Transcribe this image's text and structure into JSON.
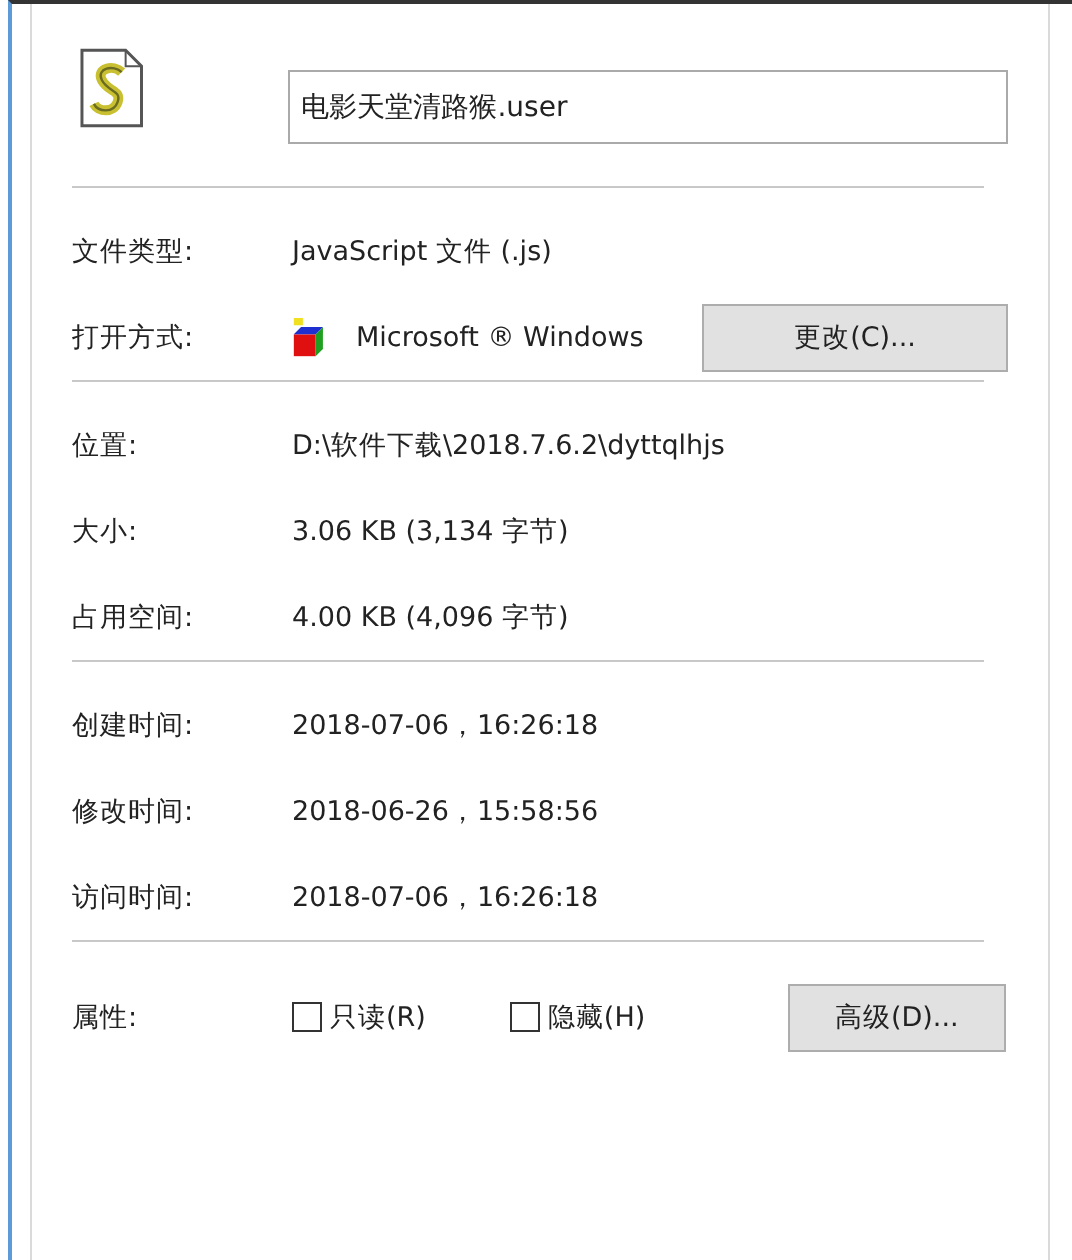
{
  "file_name": {
    "value": "电影天堂清路猴.user"
  },
  "sections": [
    {
      "rows": [
        {
          "kind": "text",
          "label": "文件类型:",
          "value": "JavaScript 文件 (.js)"
        },
        {
          "kind": "app",
          "label": "打开方式:",
          "value": "Microsoft ® Windows",
          "button": "更改(C)..."
        }
      ]
    },
    {
      "rows": [
        {
          "kind": "text",
          "label": "位置:",
          "value": "D:\\软件下载\\2018.7.6.2\\dyttqlhjs"
        },
        {
          "kind": "text",
          "label": "大小:",
          "value": "3.06 KB (3,134 字节)"
        },
        {
          "kind": "text",
          "label": "占用空间:",
          "value": "4.00 KB (4,096 字节)"
        }
      ]
    },
    {
      "rows": [
        {
          "kind": "text",
          "label": "创建时间:",
          "value": "2018-07-06，16:26:18"
        },
        {
          "kind": "text",
          "label": "修改时间:",
          "value": "2018-06-26，15:58:56"
        },
        {
          "kind": "text",
          "label": "访问时间:",
          "value": "2018-07-06，16:26:18"
        }
      ]
    },
    {
      "rows": [
        {
          "kind": "attributes",
          "label": "属性:",
          "checkboxes": [
            {
              "label": "只读(R)",
              "checked": false
            },
            {
              "label": "隐藏(H)",
              "checked": false
            }
          ],
          "button": "高级(D)..."
        }
      ]
    }
  ]
}
